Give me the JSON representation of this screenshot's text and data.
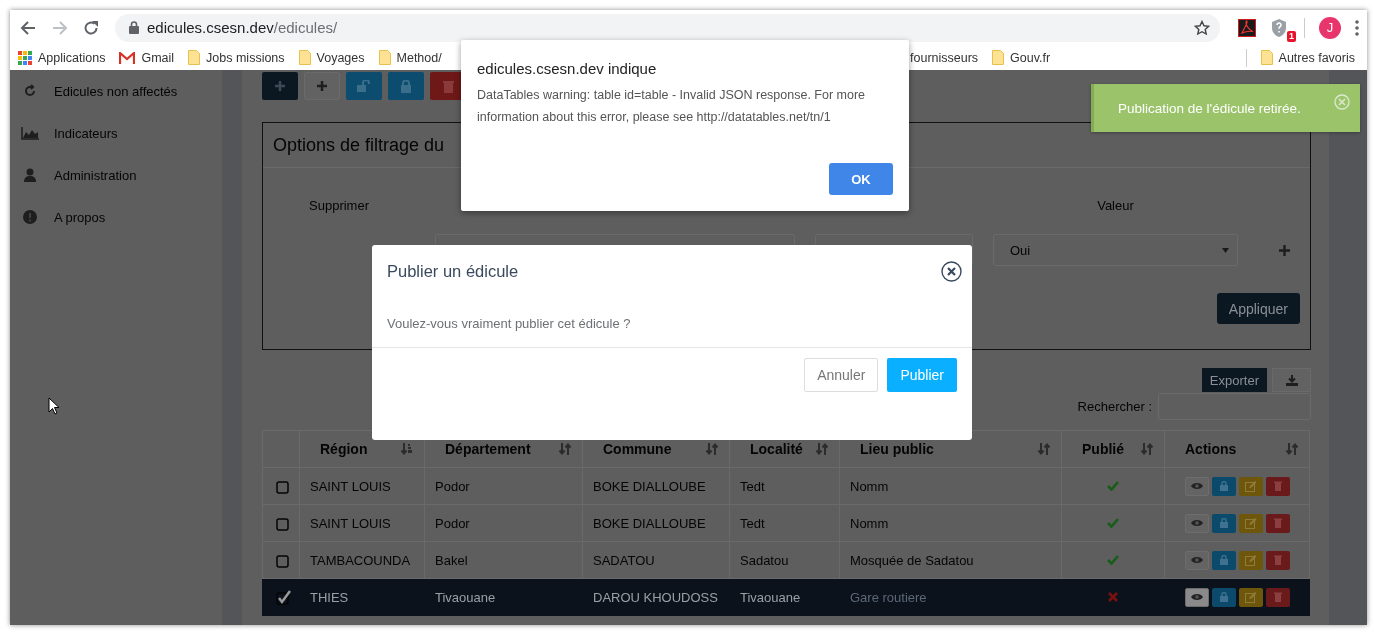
{
  "browser": {
    "url_host": "edicules.csesn.dev",
    "url_path": "/edicules/",
    "extension_badge": "1",
    "avatar": "J"
  },
  "bookmarks": [
    {
      "kind": "apps",
      "label": "Applications"
    },
    {
      "kind": "gmail",
      "label": "Gmail"
    },
    {
      "kind": "folder",
      "label": "Jobs missions"
    },
    {
      "kind": "folder",
      "label": "Voyages"
    },
    {
      "kind": "folder",
      "label": "Method/"
    },
    {
      "kind": "partial",
      "label": "fournisseurs"
    },
    {
      "kind": "folder",
      "label": "Gouv.fr"
    }
  ],
  "other_bookmarks": "Autres favoris",
  "sidebar": {
    "items": [
      {
        "kind": "refresh",
        "label": "Edicules non affectés"
      },
      {
        "kind": "chart",
        "label": "Indicateurs"
      },
      {
        "kind": "user",
        "label": "Administration"
      },
      {
        "kind": "info",
        "label": "A propos"
      }
    ]
  },
  "toolbar": [
    {
      "kind": "add-dark"
    },
    {
      "kind": "add-light"
    },
    {
      "kind": "unlock"
    },
    {
      "kind": "lock"
    },
    {
      "kind": "delete"
    }
  ],
  "filter": {
    "title": "Options de filtrage du",
    "remove_label": "Supprimer",
    "value_label": "Valeur",
    "value_select": "Oui",
    "apply": "Appliquer"
  },
  "export": "Exporter",
  "search_label": "Rechercher :",
  "table": {
    "columns": [
      {
        "label": "Région",
        "sorted": true
      },
      {
        "label": "Département",
        "sorted": false
      },
      {
        "label": "Commune",
        "sorted": false
      },
      {
        "label": "Localité",
        "sorted": false
      },
      {
        "label": "Lieu public",
        "sorted": false
      },
      {
        "label": "Publié",
        "sorted": false
      },
      {
        "label": "Actions",
        "sorted": false
      }
    ],
    "rows": [
      {
        "checked": false,
        "selected": false,
        "cells": [
          "SAINT LOUIS",
          "Podor",
          "BOKE DIALLOUBE",
          "Tedt",
          "Nomm"
        ],
        "published": true
      },
      {
        "checked": false,
        "selected": false,
        "cells": [
          "SAINT LOUIS",
          "Podor",
          "BOKE DIALLOUBE",
          "Tedt",
          "Nomm"
        ],
        "published": true
      },
      {
        "checked": false,
        "selected": false,
        "cells": [
          "TAMBACOUNDA",
          "Bakel",
          "SADATOU",
          "Sadatou",
          "Mosquée de Sadatou"
        ],
        "published": true
      },
      {
        "checked": true,
        "selected": true,
        "cells": [
          "THIES",
          "Tivaouane",
          "DAROU KHOUDOSS",
          "Tivaouane",
          "Gare routiere"
        ],
        "published": false
      }
    ]
  },
  "alert": {
    "title": "edicules.csesn.dev indique",
    "message": "DataTables warning: table id=table - Invalid JSON response. For more information about this error, please see http://datatables.net/tn/1",
    "ok": "OK"
  },
  "modal": {
    "title": "Publier un édicule",
    "message": "Voulez-vous vraiment publier cet édicule ?",
    "cancel": "Annuler",
    "confirm": "Publier"
  },
  "toast": {
    "message": "Publication de l'édicule retirée."
  }
}
